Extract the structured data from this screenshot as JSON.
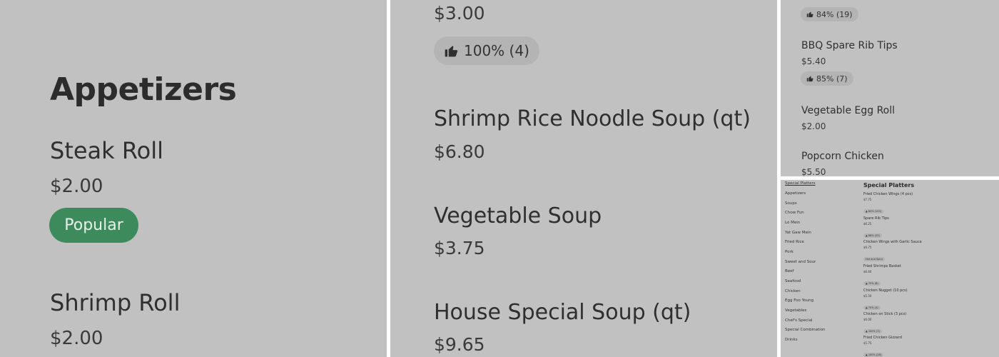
{
  "panel1": {
    "section_title": "Appetizers",
    "items": [
      {
        "name": "Steak Roll",
        "price": "$2.00",
        "tag": "Popular"
      },
      {
        "name": "Shrimp Roll",
        "price": "$2.00"
      }
    ]
  },
  "panel2": {
    "top_price": "$3.00",
    "top_rating": "100% (4)",
    "items": [
      {
        "name": "Shrimp Rice Noodle Soup (qt)",
        "price": "$6.80"
      },
      {
        "name": "Vegetable Soup",
        "price": "$3.75"
      },
      {
        "name": "House Special Soup (qt)",
        "price": "$9.65"
      }
    ]
  },
  "panel3": {
    "top_rating": "84% (19)",
    "items": [
      {
        "name": "BBQ Spare Rib Tips",
        "price": "$5.40",
        "rating": "85% (7)"
      },
      {
        "name": "Vegetable Egg Roll",
        "price": "$2.00"
      },
      {
        "name": "Popcorn Chicken",
        "price": "$5.50"
      }
    ]
  },
  "panel4": {
    "sidebar": [
      "Special Platters",
      "Appetizers",
      "Soups",
      "Chow Fun",
      "Lo Mein",
      "Yat Gaw Mein",
      "Fried Rice",
      "Pork",
      "Sweet and Sour",
      "Beef",
      "Seafood",
      "Chicken",
      "Egg Foo Young",
      "Vegetables",
      "Chef's Special",
      "Special Combination",
      "Drinks"
    ],
    "section_title": "Special Platters",
    "items": [
      {
        "name": "Fried Chicken Wings (4 pcs)",
        "price": "$7.75",
        "badge": "85% (143)"
      },
      {
        "name": "Spare Rib Tips",
        "price": "$6.25",
        "badge": "88% (33)"
      },
      {
        "name": "Chicken Wings with Garlic Sauce",
        "price": "$9.75",
        "badge": "Hot and Spicy"
      },
      {
        "name": "Fried Shrimps Basket",
        "price": "$6.60",
        "badge": "75% (8)"
      },
      {
        "name": "Chicken Nugget (10 pcs)",
        "price": "$5.50",
        "badge": "75% (4)"
      },
      {
        "name": "Chicken on Stick (3 pcs)",
        "price": "$6.00",
        "badge": "100% (3)"
      },
      {
        "name": "Fried Chicken Gizzard",
        "price": "$5.75",
        "badge": "100% (28)"
      }
    ]
  }
}
